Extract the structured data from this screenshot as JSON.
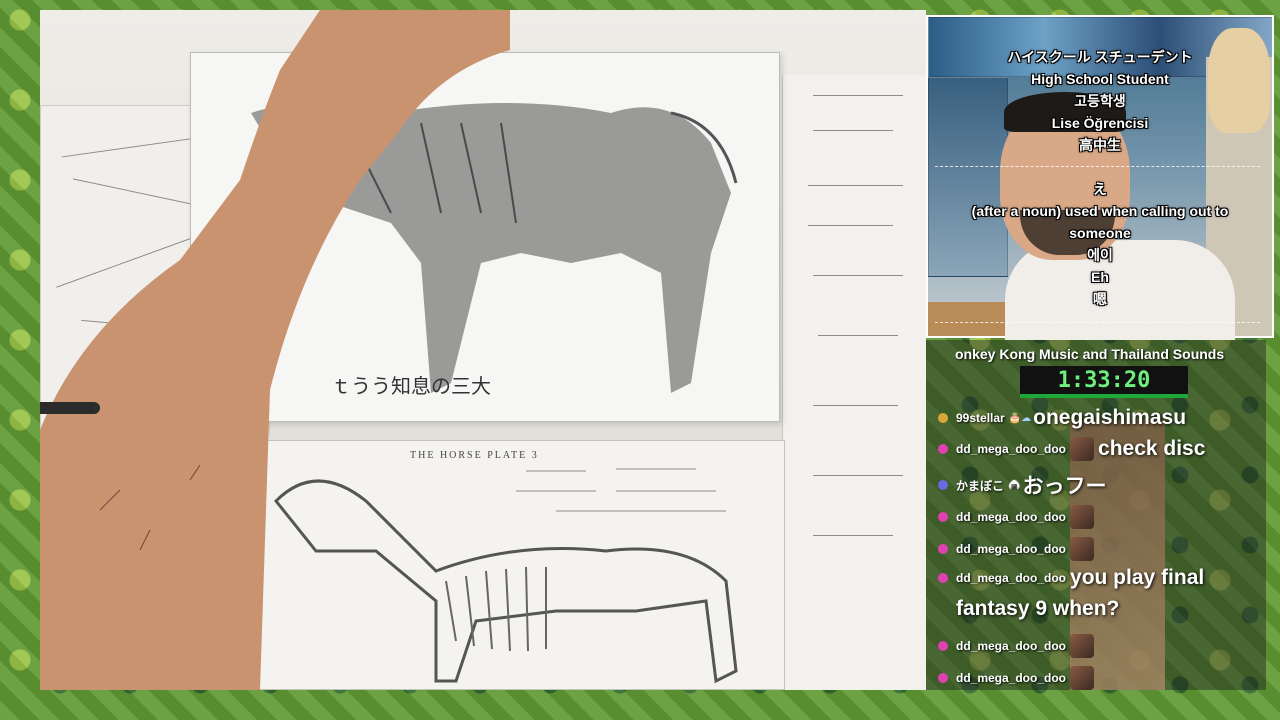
{
  "subtitles": {
    "block1": [
      "ハイスクール スチューデント",
      "High School Student",
      "고등학생",
      "Lise Öğrencisi",
      "高中生"
    ],
    "block2": [
      "え",
      "(after a noun) used when calling out to",
      "someone",
      "에이",
      "Eh",
      "嗯"
    ]
  },
  "stream": {
    "music_title": "onkey Kong Music and Thailand Sounds",
    "timer": "1:33:20"
  },
  "drawing": {
    "plate_caption": "THE HORSE    PLATE 3"
  },
  "chat": [
    {
      "user": "99stellar",
      "badge_color": "#d8a93a",
      "icons": "🎂☁",
      "text": "onegaishimasu",
      "emote": false
    },
    {
      "user": "dd_mega_doo_doo",
      "badge_color": "#e040b0",
      "icons": "",
      "text": "check disc",
      "emote": true
    },
    {
      "user": "かまぼこ",
      "badge_color": "#6a6ae0",
      "icons": "🍙",
      "text": "おっフー",
      "emote": false
    },
    {
      "user": "dd_mega_doo_doo",
      "badge_color": "#e040b0",
      "icons": "",
      "text": "",
      "emote": true
    },
    {
      "user": "dd_mega_doo_doo",
      "badge_color": "#e040b0",
      "icons": "",
      "text": "",
      "emote": true
    },
    {
      "user": "dd_mega_doo_doo",
      "badge_color": "#e040b0",
      "icons": "",
      "text": "you play final",
      "emote": false
    },
    {
      "user": "dd_mega_doo_doo",
      "badge_color": "#e040b0",
      "icons": "",
      "text": "",
      "emote": true
    },
    {
      "user": "dd_mega_doo_doo",
      "badge_color": "#e040b0",
      "icons": "",
      "text": "",
      "emote": true
    }
  ],
  "chat_wrap_text": "fantasy 9 when?"
}
